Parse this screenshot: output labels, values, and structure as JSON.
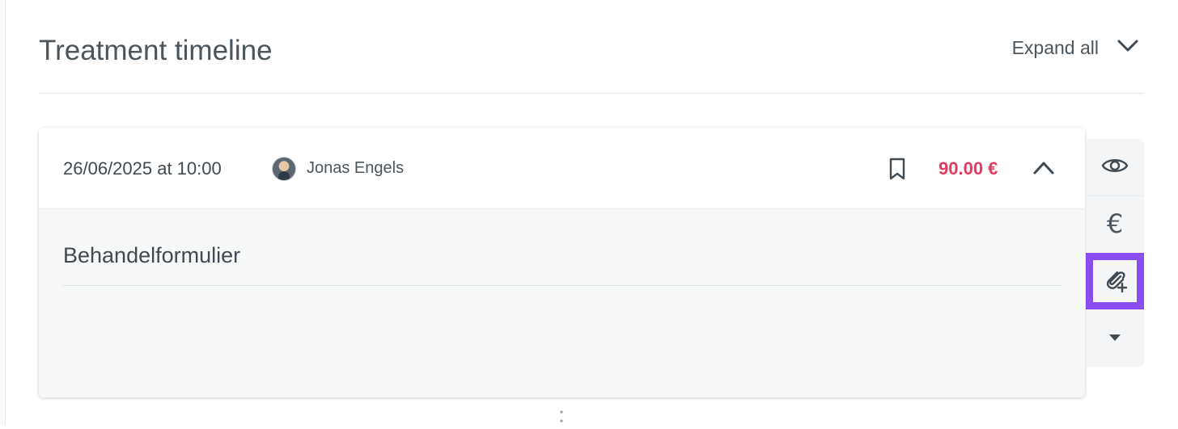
{
  "header": {
    "title": "Treatment timeline",
    "expand_label": "Expand all"
  },
  "appointment": {
    "datetime": "26/06/2025 at 10:00",
    "therapist": "Jonas Engels",
    "price": "90.00 €",
    "form_title": "Behandelformulier"
  },
  "toolbar": {
    "euro_symbol": "€",
    "items": [
      "eye-icon",
      "euro-icon",
      "attachment-add-icon",
      "caret-down-icon"
    ]
  },
  "colors": {
    "price": "#e23b5e",
    "highlight": "#8a4df0",
    "text": "#3f4a52"
  }
}
